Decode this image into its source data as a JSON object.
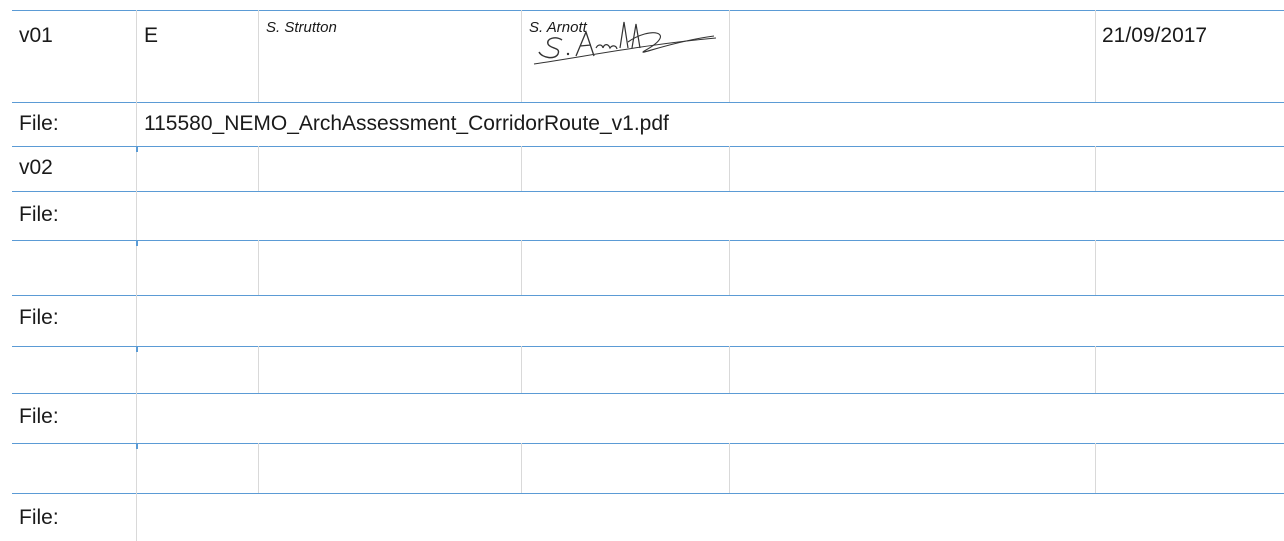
{
  "table": {
    "rows": [
      {
        "version": "v01",
        "status": "E",
        "prepared_by": "S. Strutton",
        "checked_by": "S. Arnott",
        "signature": "S. Arnott",
        "date": "21/09/2017",
        "file_label": "File:",
        "file_name": "115580_NEMO_ArchAssessment_CorridorRoute_v1.pdf"
      },
      {
        "version": "v02",
        "file_label": "File:",
        "file_name": ""
      },
      {
        "version": "",
        "file_label": "File:",
        "file_name": ""
      },
      {
        "version": "",
        "file_label": "File:",
        "file_name": ""
      },
      {
        "version": "",
        "file_label": "File:",
        "file_name": ""
      }
    ]
  },
  "colors": {
    "rule": "#5b9bd5",
    "grid": "#d9d9d9",
    "text": "#1a1a1a"
  }
}
